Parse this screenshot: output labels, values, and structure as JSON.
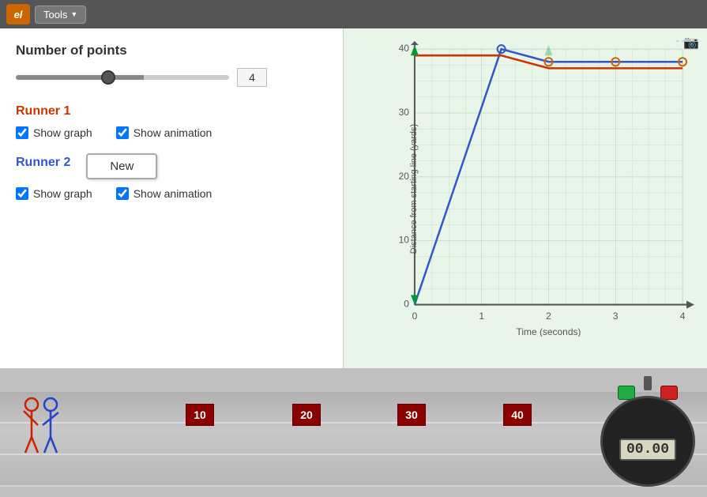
{
  "header": {
    "logo_text": "el",
    "tools_label": "Tools"
  },
  "left_panel": {
    "num_points_label": "Number of points",
    "slider_value": "4",
    "slider_min": 1,
    "slider_max": 8,
    "slider_current": 4,
    "runner1": {
      "label": "Runner 1",
      "show_graph_label": "Show graph",
      "show_animation_label": "Show animation",
      "show_graph_checked": true,
      "show_animation_checked": true
    },
    "runner2": {
      "label": "Runner 2",
      "new_button_label": "New",
      "show_graph_label": "Show graph",
      "show_animation_label": "Show animation",
      "show_graph_checked": true,
      "show_animation_checked": true
    }
  },
  "graph": {
    "y_axis_label": "Distance from starting line (yards)",
    "x_axis_label": "Time (seconds)",
    "y_max": 40,
    "x_max": 4,
    "grid_y": [
      0,
      10,
      20,
      30,
      40
    ],
    "grid_x": [
      0,
      1,
      2,
      3,
      4
    ]
  },
  "track": {
    "yard_markers": [
      "10",
      "20",
      "30",
      "40"
    ],
    "stopwatch_display": "00.00"
  }
}
